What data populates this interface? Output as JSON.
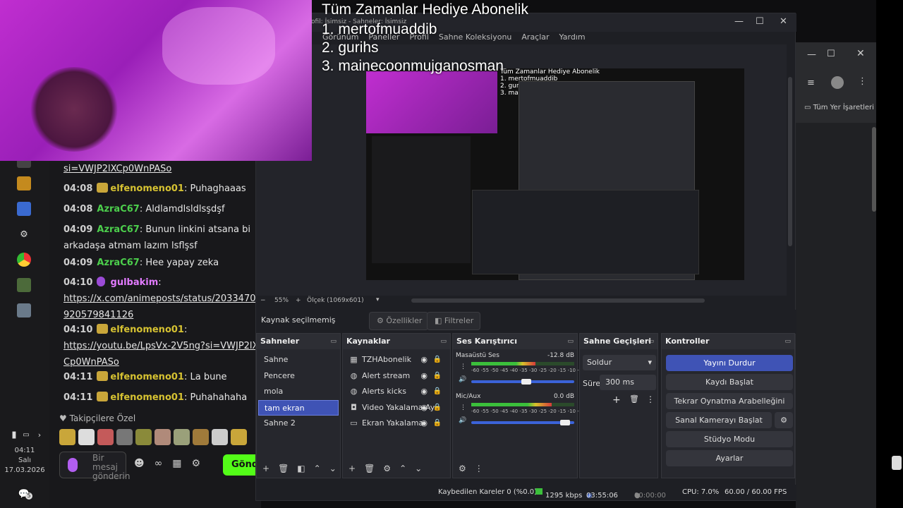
{
  "overlay": {
    "title": "Tüm Zamanlar Hediye  Abonelik",
    "ranks": [
      "1. mertofmuaddib",
      "2. gurihs",
      "3. mainecoonmujganosman"
    ]
  },
  "taskbar": {
    "time": "04:11",
    "day": "Salı",
    "date": "17.03.2026",
    "notif_count": "5"
  },
  "chat": {
    "messages": [
      {
        "link": "si=VWJP2lXCp0WnPASo"
      },
      {
        "time": "04:08",
        "user": "elfenomeno01",
        "text": "Puhaghaaas"
      },
      {
        "time": "04:08",
        "user": "AzraC67",
        "text": "Aldlamdlsldlsşdşf"
      },
      {
        "time": "04:09",
        "user": "AzraC67",
        "text": "Bunun linkini atsana bi arkadaşa atmam lazım lsflşsf"
      },
      {
        "time": "04:09",
        "user": "AzraC67",
        "text": "Hee yapay zeka"
      },
      {
        "time": "04:10",
        "user": "gulbakim",
        "link": "https://x.com/animeposts/status/2033470920579841126"
      },
      {
        "time": "04:10",
        "user": "elfenomeno01",
        "link": "https://youtu.be/LpsVx-2V5ng?si=VWJP2lXCp0WnPASo"
      },
      {
        "time": "04:11",
        "user": "elfenomeno01",
        "text": "La bune"
      },
      {
        "time": "04:11",
        "user": "elfenomeno01",
        "text": "Puhahahaha"
      }
    ],
    "follower_label": "Takipçilere Özel",
    "input_placeholder": "Bir mesaj gönderin",
    "send_label": "Gönder"
  },
  "browser": {
    "bookmarks_label": "Tüm Yer İşaretleri"
  },
  "obs": {
    "title_fragment": "ofil: İsimsiz - Sahneler: İsimsiz",
    "menu": [
      "Görünüm",
      "Paneller",
      "Profil",
      "Sahne Koleksiyonu",
      "Araçlar",
      "Yardım"
    ],
    "zoom": "55%",
    "scale": "Ölçek (1069x601)",
    "no_source": "Kaynak seçilmemiş",
    "properties_label": "Özellikler",
    "filters_label": "Filtreler",
    "scenes": {
      "title": "Sahneler",
      "items": [
        "Sahne",
        "Pencere",
        "mola",
        "tam ekran",
        "Sahne 2"
      ]
    },
    "sources": {
      "title": "Kaynaklar",
      "items": [
        "TZHAbonelik",
        "Alert stream",
        "Alerts kicks",
        "Video Yakalama Ay",
        "Ekran Yakalama"
      ]
    },
    "mixer": {
      "title": "Ses Karıştırıcı",
      "channels": [
        {
          "name": "Masaüstü Ses",
          "db": "-12.8 dB",
          "level": 0.62,
          "volume": 0.58
        },
        {
          "name": "Mic/Aux",
          "db": "0.0 dB",
          "level": 0.78,
          "volume": 0.96
        }
      ],
      "scale_labels": "-60 -55 -50 -45 -40 -35 -30 -25 -20 -15 -10 -5 0"
    },
    "transitions": {
      "title": "Sahne Geçişleri",
      "selected": "Soldur",
      "duration_label": "Süre",
      "duration": "300 ms"
    },
    "controls": {
      "title": "Kontroller",
      "buttons": [
        "Yayını Durdur",
        "Kaydı Başlat",
        "Tekrar Oynatma Arabelleğini Başlat",
        "Sanal Kamerayı Başlat",
        "Stüdyo Modu",
        "Ayarlar"
      ]
    },
    "status": {
      "dropped": "Kaybedilen Kareler 0 (%0.0)",
      "bitrate": "1295 kbps",
      "stream_time": "03:55:06",
      "rec_time": "00:00:00",
      "cpu": "CPU: 7.0%",
      "fps": "60.00 / 60.00 FPS"
    }
  }
}
